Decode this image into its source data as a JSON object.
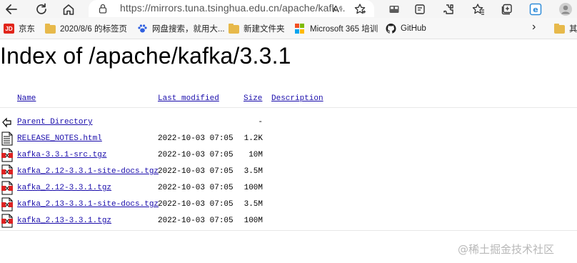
{
  "browser": {
    "url": "https://mirrors.tuna.tsinghua.edu.cn/apache/kafk...",
    "reader_glyph": "A⁶",
    "colors": {
      "toolbar_bg": "#f5f5f5",
      "link": "#1a0dab"
    }
  },
  "bookmarks": [
    {
      "label": "京东",
      "icon": "jd-logo-icon",
      "badge": "JD"
    },
    {
      "label": "2020/8/6 的标签页",
      "icon": "folder-icon"
    },
    {
      "label": "网盘搜索，就用大...",
      "icon": "paw-icon"
    },
    {
      "label": "新建文件夹",
      "icon": "folder-icon"
    },
    {
      "label": "Microsoft 365 培训",
      "icon": "microsoft-logo-icon"
    },
    {
      "label": "GitHub",
      "icon": "github-icon"
    }
  ],
  "bookmarks_overflow": "›",
  "bookmarks_other": "其",
  "page": {
    "title": "Index of /apache/kafka/3.3.1",
    "columns": {
      "name": "Name",
      "modified": "Last modified",
      "size": "Size",
      "description": "Description"
    },
    "entries": [
      {
        "name": "Parent Directory",
        "modified": "",
        "size": "-",
        "icon": "back-arrow-icon"
      },
      {
        "name": "RELEASE_NOTES.html",
        "modified": "2022-10-03 07:05",
        "size": "1.2K",
        "icon": "text-file-icon"
      },
      {
        "name": "kafka-3.3.1-src.tgz",
        "modified": "2022-10-03 07:05",
        "size": "10M",
        "icon": "archive-file-icon"
      },
      {
        "name": "kafka_2.12-3.3.1-site-docs.tgz",
        "modified": "2022-10-03 07:05",
        "size": "3.5M",
        "icon": "archive-file-icon"
      },
      {
        "name": "kafka_2.12-3.3.1.tgz",
        "modified": "2022-10-03 07:05",
        "size": "100M",
        "icon": "archive-file-icon"
      },
      {
        "name": "kafka_2.13-3.3.1-site-docs.tgz",
        "modified": "2022-10-03 07:05",
        "size": "3.5M",
        "icon": "archive-file-icon"
      },
      {
        "name": "kafka_2.13-3.3.1.tgz",
        "modified": "2022-10-03 07:05",
        "size": "100M",
        "icon": "archive-file-icon"
      }
    ]
  },
  "watermark": "@稀土掘金技术社区"
}
